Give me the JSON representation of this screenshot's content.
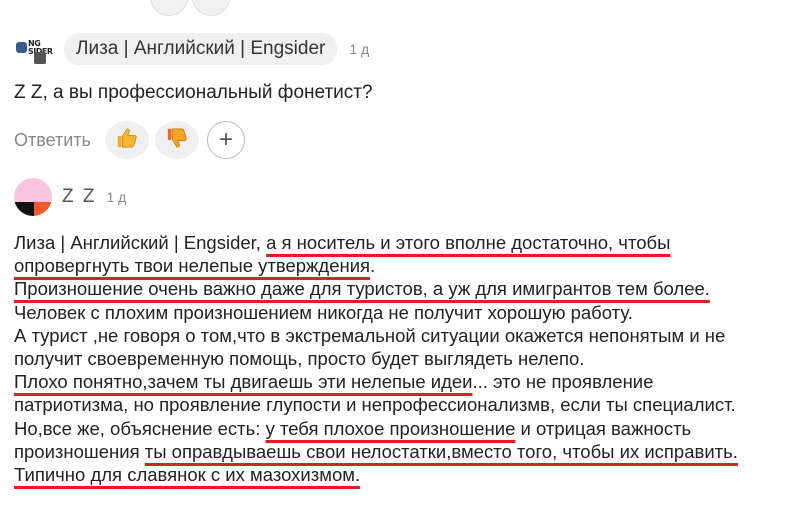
{
  "comment1": {
    "author": "Лиза | Английский | Engsider",
    "time": "1 д",
    "text": "Z Z, а вы профессиональный фонетист?",
    "reply_label": "Ответить",
    "avatar_text": "NG SIDER"
  },
  "comment2": {
    "author": "Z Z",
    "time": "1 д",
    "lines": [
      {
        "a": "Лиза | Английский | Engsider, ",
        "u": "а я носитель и этого вполне достаточно, чтобы"
      },
      {
        "u": "опровергнуть твои нелепые утверждения",
        "b": "."
      },
      {
        "u": "Произношение очень важно даже для туристов, а уж для имигрантов тем более."
      },
      {
        "a": "Человек с плохим произношением никогда не получит хорошую работу."
      },
      {
        "a": "А турист ,не говоря о том,что в экстремальной ситуации окажется непонятым и не"
      },
      {
        "a": "получит своевременную помощь, просто будет выглядеть нелепо."
      },
      {
        "u": "Плохо понятно,зачем ты двигаешь эти нелепые идеи",
        "b": "... это не проявление"
      },
      {
        "a": "патриотизма, но проявление глупости и непрофессионализмв, если ты специалист."
      },
      {
        "a": "Но,все же, объяснение есть: ",
        "u": "у тебя плохое произношение",
        "b": " и отрицая важность"
      },
      {
        "a": "произношения ",
        "u": "ты оправдываешь свои нелостатки,вместо того, чтобы их исправить."
      },
      {
        "u": "Типично для славянок с их мазохизмом."
      }
    ]
  },
  "colors": {
    "underline": "#e02020",
    "chip_bg": "#f0f0f0"
  }
}
